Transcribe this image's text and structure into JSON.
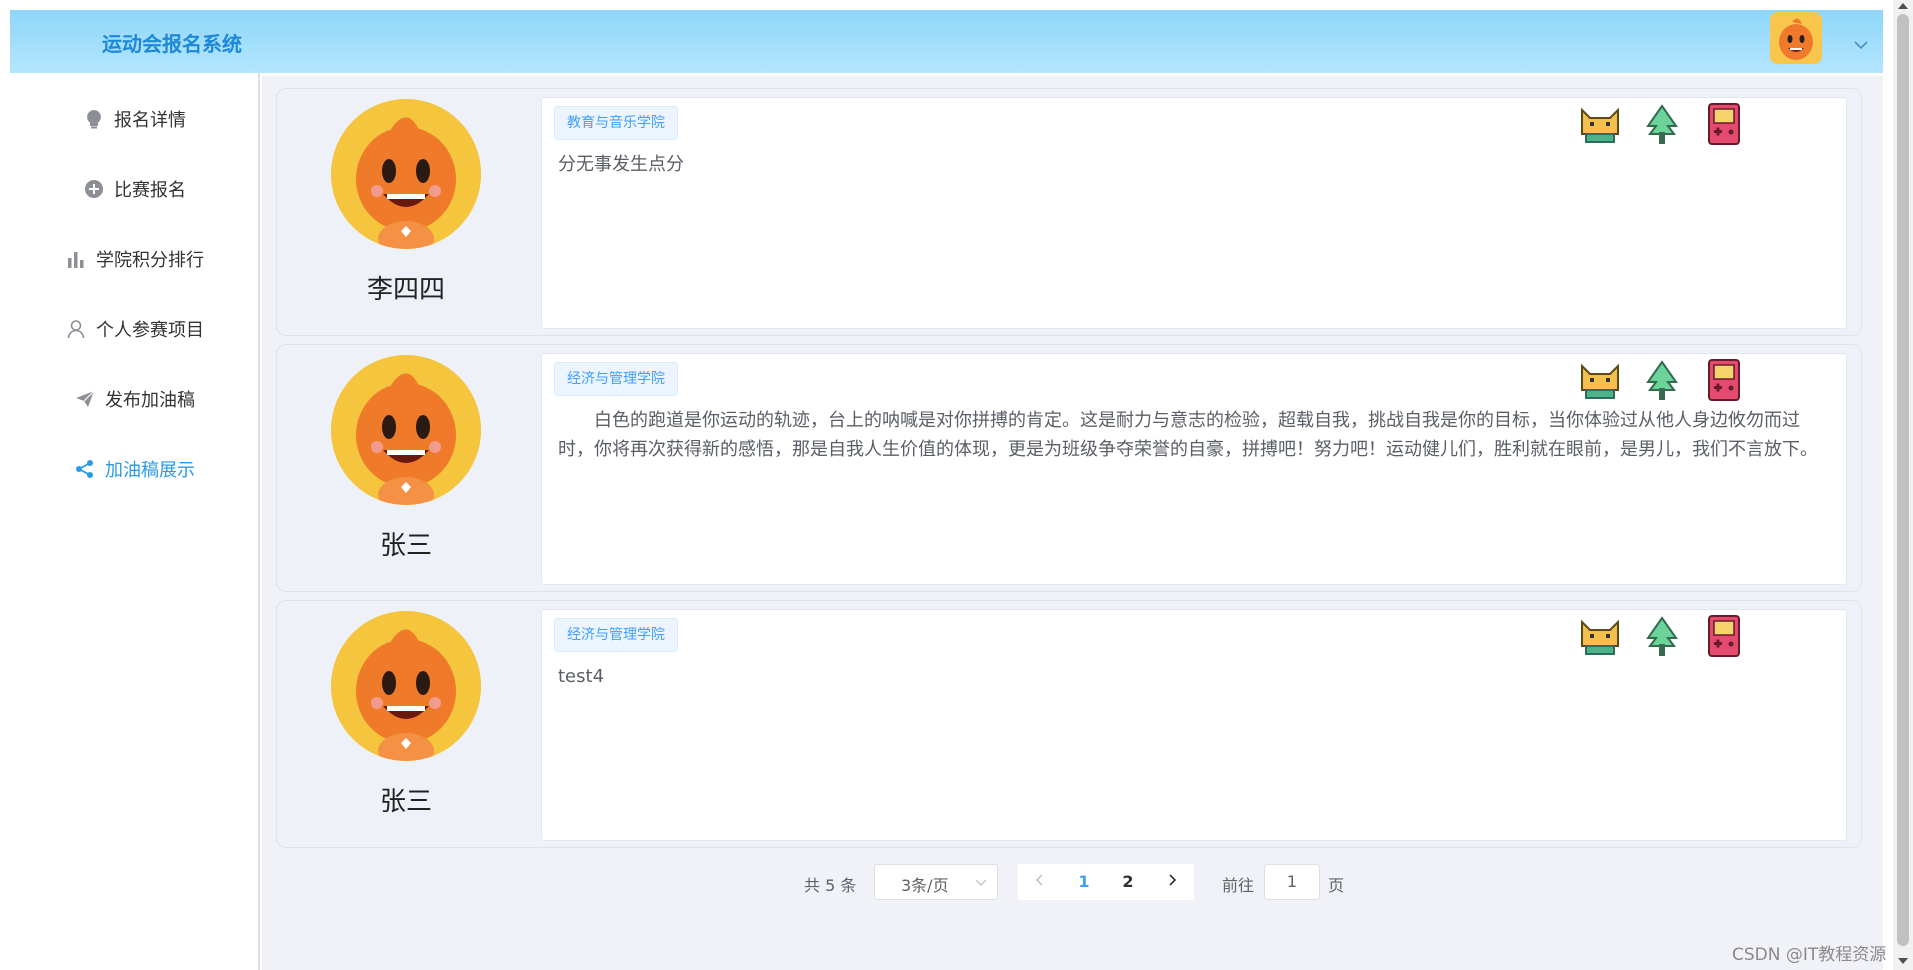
{
  "header": {
    "brand": "运动会报名系统"
  },
  "sidebar": {
    "items": [
      {
        "label": "报名详情",
        "icon": "lightbulb-icon",
        "active": false
      },
      {
        "label": "比赛报名",
        "icon": "plus-circle-icon",
        "active": false
      },
      {
        "label": "学院积分排行",
        "icon": "bar-chart-icon",
        "active": false
      },
      {
        "label": "个人参赛项目",
        "icon": "user-icon",
        "active": false
      },
      {
        "label": "发布加油稿",
        "icon": "paper-plane-icon",
        "active": false
      },
      {
        "label": "加油稿展示",
        "icon": "share-icon",
        "active": true
      }
    ]
  },
  "posts": [
    {
      "author": "李四四",
      "college": "教育与音乐学院",
      "content": "分无事发生点分"
    },
    {
      "author": "张三",
      "college": "经济与管理学院",
      "content": "白色的跑道是你运动的轨迹，台上的呐喊是对你拼搏的肯定。这是耐力与意志的检验，超载自我，挑战自我是你的目标，当你体验过从他人身边攸勿而过时，你将再次获得新的感悟，那是自我人生价值的体现，更是为班级争夺荣誉的自豪，拼搏吧！努力吧！运动健儿们，胜利就在眼前，是男儿，我们不言放下。"
    },
    {
      "author": "张三",
      "college": "经济与管理学院",
      "content": "test4"
    }
  ],
  "post_actions": [
    "cat-icon",
    "tree-icon",
    "gameboy-icon"
  ],
  "pagination": {
    "total": "共 5 条",
    "page_size": "3条/页",
    "pages": [
      "1",
      "2"
    ],
    "current": "1",
    "goto_label": "前往",
    "goto_value": "1",
    "page_suffix": "页"
  },
  "watermark": "CSDN @IT教程资源",
  "colors": {
    "accent": "#409eff",
    "header_from": "#8ed6f9",
    "header_to": "#b4e6fd",
    "brand": "#1e88d8"
  }
}
